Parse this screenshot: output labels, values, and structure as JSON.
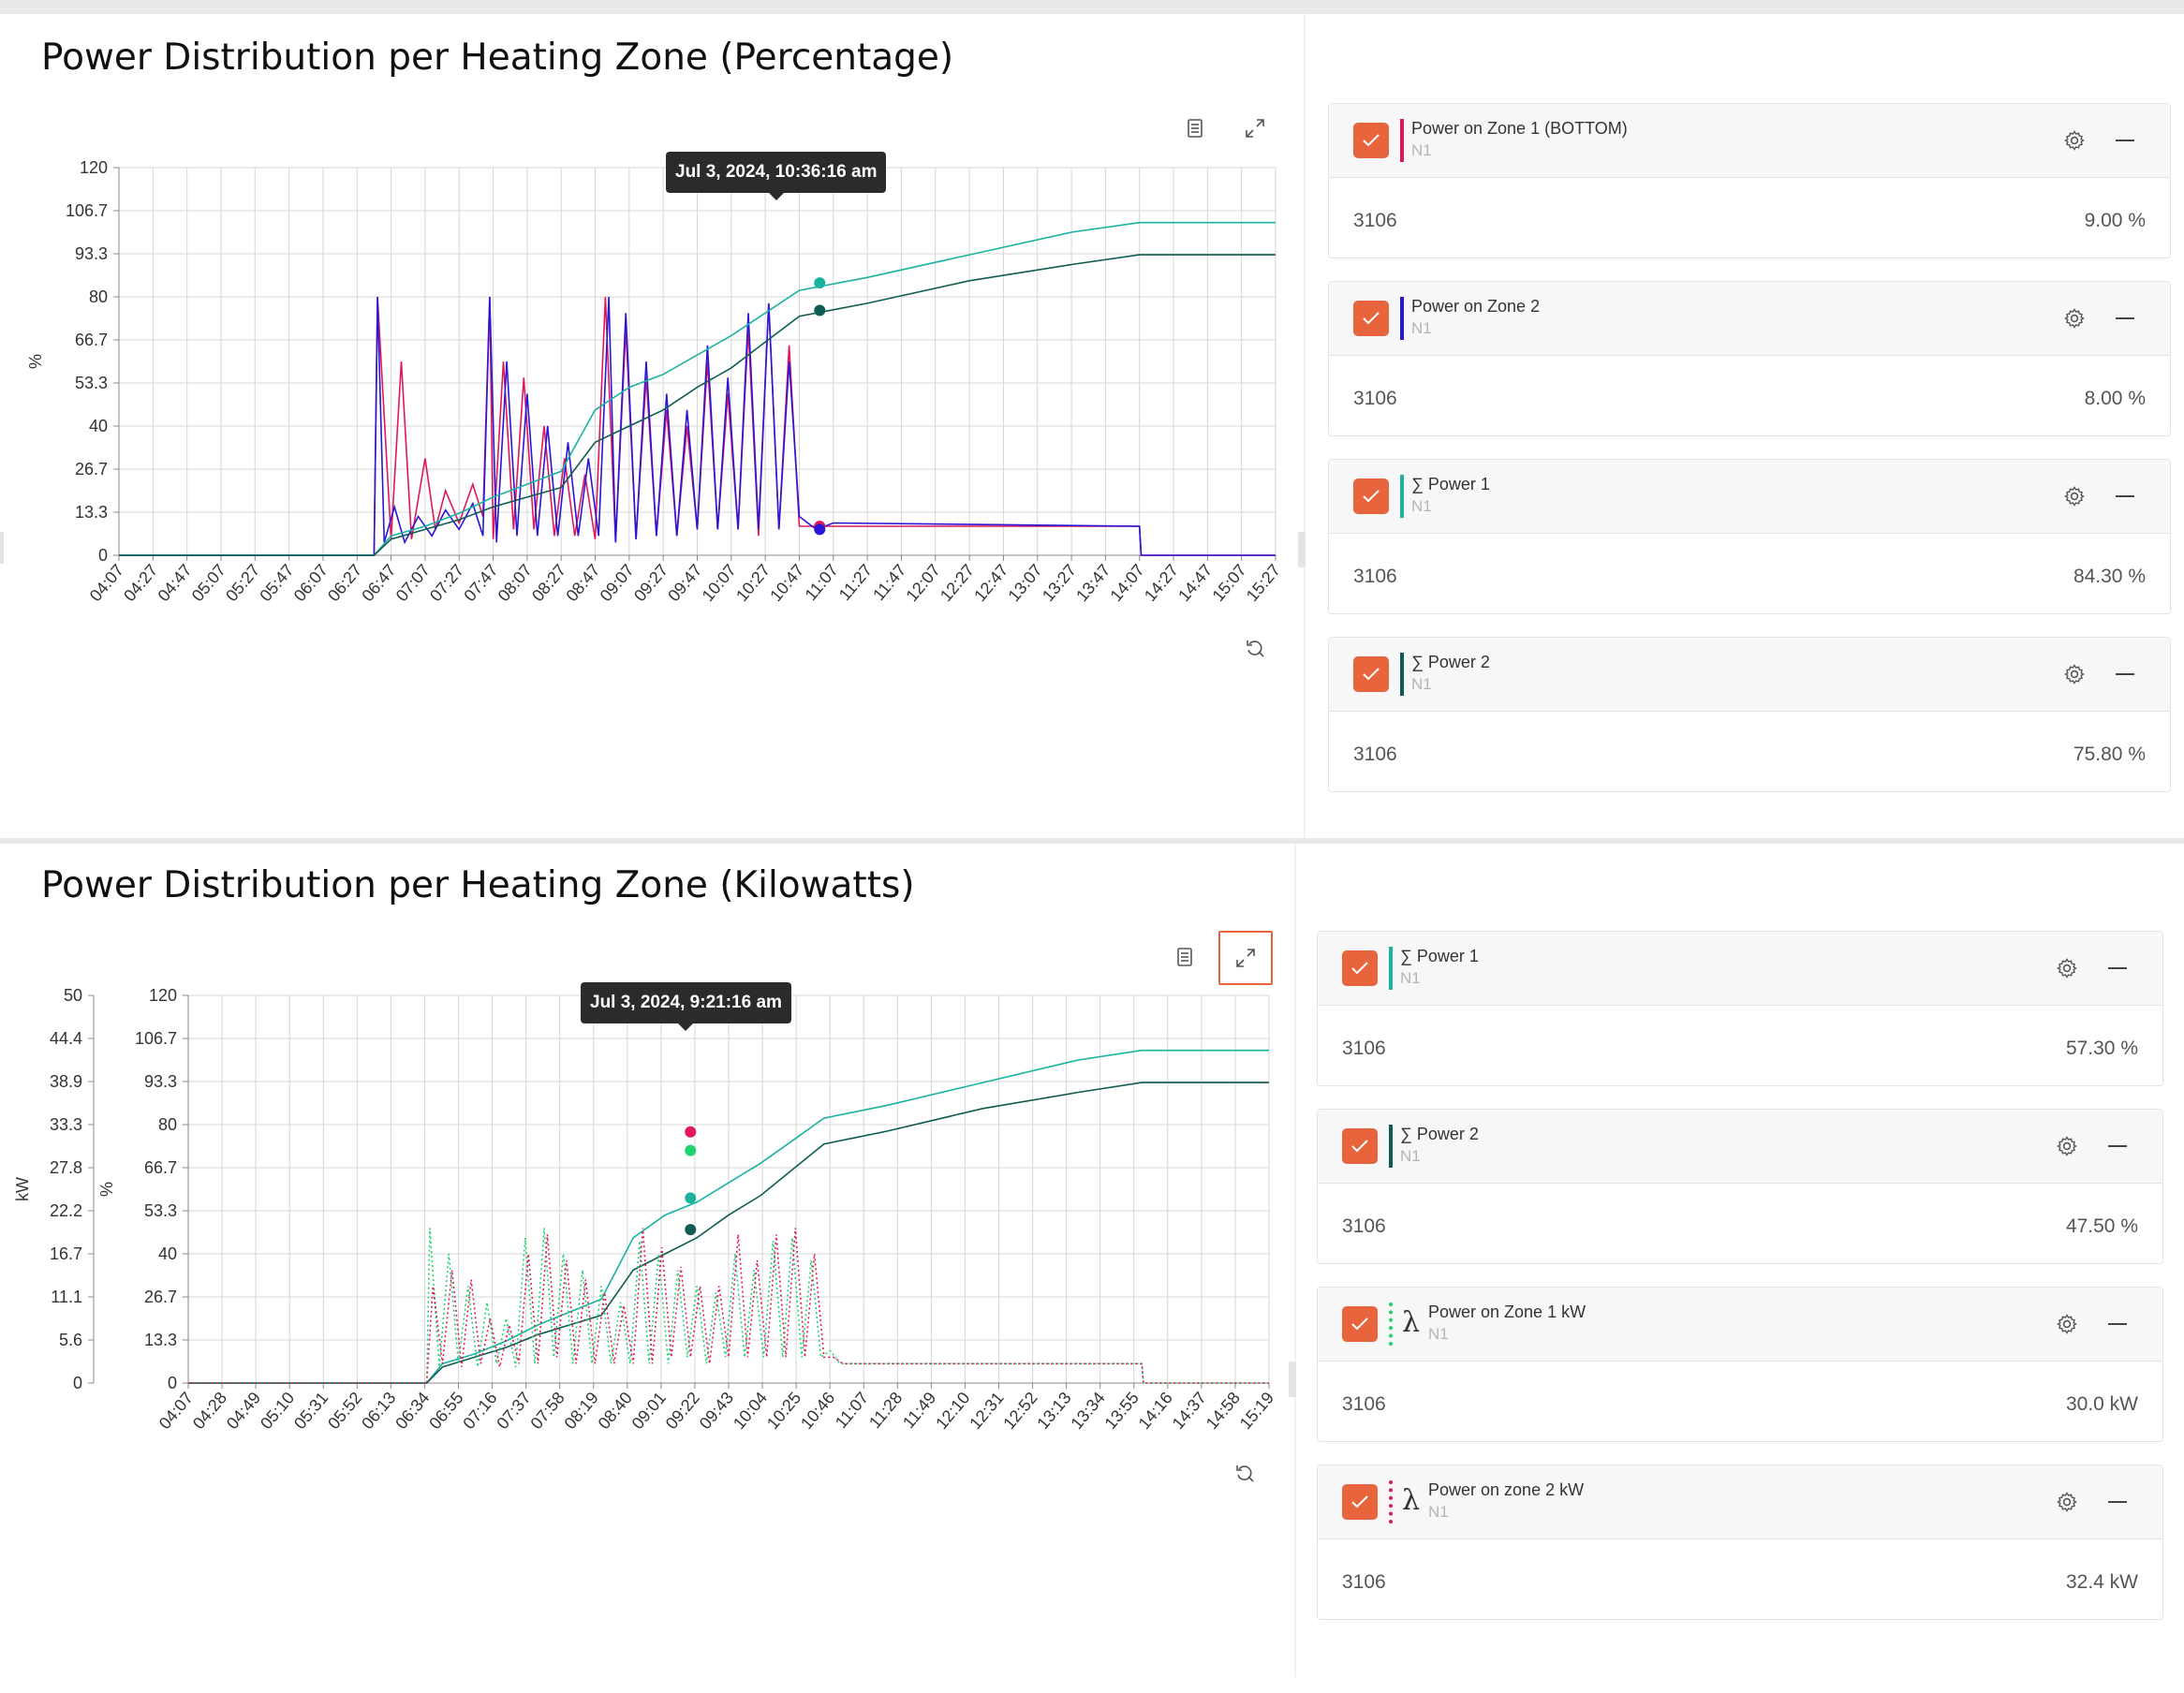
{
  "panel1": {
    "title": "Power Distribution per Heating Zone (Percentage)",
    "tooltip": "Jul 3, 2024, 10:36:16 am",
    "icons": [
      "list-icon",
      "expand-icon",
      "reset-zoom-icon"
    ],
    "legend": [
      {
        "name": "Power on Zone 1 (BOTTOM)",
        "sub": "N1",
        "id": "3106",
        "value": "9.00 %",
        "color": "#e0185a",
        "style": "solid"
      },
      {
        "name": "Power on Zone 2",
        "sub": "N1",
        "id": "3106",
        "value": "8.00 %",
        "color": "#2a16d6",
        "style": "solid"
      },
      {
        "name": "∑ Power 1",
        "sub": "N1",
        "id": "3106",
        "value": "84.30 %",
        "color": "#1bb3a0",
        "style": "solid"
      },
      {
        "name": "∑ Power 2",
        "sub": "N1",
        "id": "3106",
        "value": "75.80 %",
        "color": "#0f5c52",
        "style": "solid"
      }
    ]
  },
  "panel2": {
    "title": "Power Distribution per Heating Zone (Kilowatts)",
    "tooltip": "Jul 3, 2024, 9:21:16 am",
    "icons": [
      "list-icon",
      "expand-icon",
      "reset-zoom-icon"
    ],
    "legend": [
      {
        "name": "∑ Power 1",
        "sub": "N1",
        "id": "3106",
        "value": "57.30 %",
        "color": "#1bb3a0",
        "style": "solid"
      },
      {
        "name": "∑ Power 2",
        "sub": "N1",
        "id": "3106",
        "value": "47.50 %",
        "color": "#0f5c52",
        "style": "solid"
      },
      {
        "name": "Power on Zone 1 kW",
        "sub": "N1",
        "id": "3106",
        "value": "30.0 kW",
        "color": "#1fd36e",
        "style": "dotted",
        "lambda": "λ"
      },
      {
        "name": "Power on zone 2 kW",
        "sub": "N1",
        "id": "3106",
        "value": "32.4 kW",
        "color": "#e0185a",
        "style": "dotted",
        "lambda": "λ"
      }
    ]
  },
  "colors": {
    "accent": "#e8643c",
    "zone1": "#e0185a",
    "zone2": "#2a16d6",
    "sum1": "#1bb3a0",
    "sum2": "#0f5c52",
    "zone1kw": "#1fd36e"
  },
  "chart_data": [
    {
      "type": "line",
      "ylabel": "%",
      "ylim": [
        0,
        120
      ],
      "yticks": [
        "0",
        "13.3",
        "26.7",
        "40",
        "53.3",
        "66.7",
        "80",
        "93.3",
        "106.7",
        "120"
      ],
      "xticks": [
        "04:07",
        "04:27",
        "04:47",
        "05:07",
        "05:27",
        "05:47",
        "06:07",
        "06:27",
        "06:47",
        "07:07",
        "07:27",
        "07:47",
        "08:07",
        "08:27",
        "08:47",
        "09:07",
        "09:27",
        "09:47",
        "10:07",
        "10:27",
        "10:47",
        "11:07",
        "11:27",
        "11:47",
        "12:07",
        "12:27",
        "12:47",
        "13:07",
        "13:27",
        "13:47",
        "14:07",
        "14:27",
        "14:47",
        "15:07",
        "15:27"
      ],
      "grid": true,
      "series": [
        {
          "name": "Power on Zone 1 (BOTTOM)",
          "color": "#e0185a",
          "x_minutes": [
            0,
            150,
            152,
            160,
            166,
            172,
            180,
            186,
            192,
            200,
            208,
            214,
            218,
            220,
            226,
            232,
            238,
            244,
            250,
            256,
            262,
            268,
            274,
            280,
            286,
            292,
            298,
            304,
            310,
            316,
            322,
            328,
            334,
            340,
            346,
            352,
            358,
            364,
            370,
            376,
            382,
            388,
            394,
            400,
            600,
            601,
            680
          ],
          "values": [
            0,
            0,
            80,
            5,
            60,
            5,
            30,
            8,
            20,
            10,
            22,
            12,
            80,
            5,
            60,
            8,
            55,
            8,
            40,
            6,
            30,
            6,
            25,
            5,
            80,
            4,
            70,
            5,
            55,
            6,
            45,
            6,
            40,
            8,
            60,
            8,
            50,
            8,
            70,
            6,
            78,
            8,
            65,
            9,
            9,
            0,
            0
          ]
        },
        {
          "name": "Power on Zone 2",
          "color": "#2a16d6",
          "x_minutes": [
            0,
            150,
            152,
            156,
            162,
            168,
            176,
            184,
            192,
            200,
            208,
            214,
            218,
            222,
            228,
            234,
            240,
            246,
            252,
            258,
            264,
            270,
            276,
            282,
            288,
            292,
            298,
            304,
            310,
            316,
            322,
            328,
            334,
            340,
            346,
            352,
            358,
            364,
            370,
            376,
            382,
            388,
            394,
            400,
            410,
            420,
            600,
            601,
            680
          ],
          "values": [
            0,
            0,
            80,
            4,
            15,
            4,
            12,
            6,
            14,
            8,
            16,
            6,
            80,
            4,
            60,
            6,
            50,
            6,
            40,
            6,
            35,
            6,
            30,
            6,
            80,
            4,
            75,
            5,
            60,
            6,
            50,
            6,
            45,
            8,
            65,
            8,
            55,
            8,
            75,
            8,
            78,
            8,
            60,
            12,
            8,
            10,
            9,
            0,
            0
          ]
        },
        {
          "name": "∑ Power 1",
          "color": "#1bb3a0",
          "x_minutes": [
            0,
            150,
            160,
            180,
            200,
            220,
            240,
            260,
            280,
            300,
            320,
            340,
            360,
            380,
            400,
            420,
            440,
            500,
            560,
            600,
            680
          ],
          "values": [
            0,
            0,
            6,
            9,
            13,
            18,
            22,
            26,
            45,
            52,
            56,
            62,
            68,
            75,
            82,
            84,
            86,
            93,
            100,
            103,
            103
          ]
        },
        {
          "name": "∑ Power 2",
          "color": "#0f5c52",
          "x_minutes": [
            0,
            150,
            160,
            180,
            200,
            220,
            240,
            260,
            280,
            300,
            320,
            340,
            360,
            380,
            400,
            420,
            440,
            500,
            560,
            600,
            680
          ],
          "values": [
            0,
            0,
            5,
            8,
            11,
            15,
            18,
            21,
            35,
            40,
            45,
            52,
            58,
            66,
            74,
            76,
            78,
            85,
            90,
            93,
            93
          ]
        }
      ]
    },
    {
      "type": "line",
      "ylabel_left": "kW",
      "ylabel_right": "%",
      "ylim_left": [
        0,
        50
      ],
      "ylim_right": [
        0,
        120
      ],
      "yticks_left": [
        "0",
        "5.6",
        "11.1",
        "16.7",
        "22.2",
        "27.8",
        "33.3",
        "38.9",
        "44.4",
        "50"
      ],
      "yticks_right": [
        "0",
        "13.3",
        "26.7",
        "40",
        "53.3",
        "66.7",
        "80",
        "93.3",
        "106.7",
        "120"
      ],
      "xticks": [
        "04:07",
        "04:28",
        "04:49",
        "05:10",
        "05:31",
        "05:52",
        "06:13",
        "06:34",
        "06:55",
        "07:16",
        "07:37",
        "07:58",
        "08:19",
        "08:40",
        "09:01",
        "09:22",
        "09:43",
        "10:04",
        "10:25",
        "10:46",
        "11:07",
        "11:28",
        "11:49",
        "12:10",
        "12:31",
        "12:52",
        "13:13",
        "13:34",
        "13:55",
        "14:16",
        "14:37",
        "14:58",
        "15:19"
      ],
      "grid": true,
      "series": [
        {
          "name": "∑ Power 1",
          "color": "#1bb3a0",
          "x_minutes": [
            0,
            150,
            160,
            180,
            200,
            220,
            240,
            260,
            280,
            300,
            320,
            340,
            360,
            380,
            400,
            420,
            440,
            500,
            560,
            600,
            680
          ],
          "values": [
            0,
            0,
            6,
            9,
            13,
            18,
            22,
            26,
            45,
            52,
            56,
            62,
            68,
            75,
            82,
            84,
            86,
            93,
            100,
            103,
            103
          ]
        },
        {
          "name": "∑ Power 2",
          "color": "#0f5c52",
          "x_minutes": [
            0,
            150,
            160,
            180,
            200,
            220,
            240,
            260,
            280,
            300,
            320,
            340,
            360,
            380,
            400,
            420,
            440,
            500,
            560,
            600,
            680
          ],
          "values": [
            0,
            0,
            5,
            8,
            11,
            15,
            18,
            21,
            35,
            40,
            45,
            52,
            58,
            66,
            74,
            76,
            78,
            85,
            90,
            93,
            93
          ]
        },
        {
          "name": "Power on Zone 1 kW",
          "color": "#1fd36e",
          "x_minutes": [
            0,
            150,
            152,
            158,
            164,
            170,
            176,
            182,
            188,
            194,
            200,
            206,
            212,
            218,
            224,
            230,
            236,
            242,
            248,
            254,
            260,
            266,
            272,
            278,
            284,
            290,
            296,
            302,
            308,
            314,
            320,
            326,
            332,
            338,
            344,
            350,
            356,
            362,
            368,
            374,
            380,
            386,
            392,
            398,
            404,
            410,
            600,
            601,
            680
          ],
          "values": [
            0,
            0,
            48,
            5,
            40,
            6,
            30,
            5,
            25,
            6,
            20,
            5,
            45,
            6,
            48,
            8,
            40,
            6,
            35,
            6,
            30,
            6,
            25,
            6,
            44,
            6,
            40,
            6,
            35,
            8,
            30,
            6,
            28,
            8,
            40,
            8,
            35,
            8,
            44,
            8,
            45,
            8,
            38,
            8,
            10,
            6,
            6,
            0,
            0
          ]
        },
        {
          "name": "Power on zone 2 kW",
          "color": "#e0185a",
          "x_minutes": [
            0,
            150,
            154,
            160,
            166,
            172,
            178,
            184,
            190,
            196,
            202,
            208,
            214,
            220,
            226,
            232,
            238,
            244,
            250,
            256,
            262,
            268,
            274,
            280,
            286,
            292,
            298,
            304,
            310,
            316,
            322,
            328,
            334,
            340,
            346,
            352,
            358,
            364,
            370,
            376,
            382,
            388,
            394,
            400,
            406,
            412,
            600,
            601,
            680
          ],
          "values": [
            0,
            0,
            30,
            6,
            35,
            5,
            32,
            6,
            20,
            5,
            18,
            6,
            40,
            6,
            46,
            8,
            38,
            6,
            32,
            6,
            28,
            6,
            24,
            6,
            48,
            6,
            42,
            8,
            36,
            8,
            30,
            6,
            30,
            8,
            46,
            8,
            38,
            8,
            46,
            8,
            48,
            8,
            40,
            8,
            8,
            6,
            6,
            0,
            0
          ]
        }
      ]
    }
  ]
}
